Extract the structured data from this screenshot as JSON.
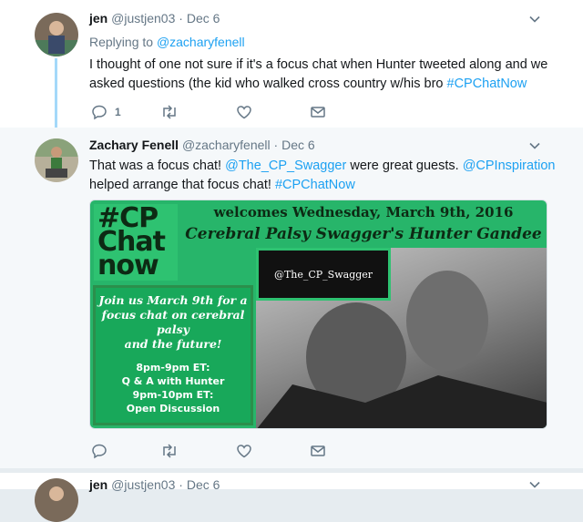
{
  "tweets": [
    {
      "name": "jen",
      "handle": "@justjen03",
      "separator": "·",
      "time": "Dec 6",
      "replying_prefix": "Replying to",
      "replying_to": "@zacharyfenell",
      "text": "I thought of one not sure if it's a focus chat when Hunter tweeted along and we asked questions (the kid who walked cross country w/his bro",
      "hashtag": "#CPChatNow",
      "reply_count": "1",
      "retweet_count": "",
      "like_count": ""
    },
    {
      "name": "Zachary Fenell",
      "handle": "@zacharyfenell",
      "separator": "·",
      "time": "Dec 6",
      "text_part1": "That was a focus chat!",
      "mention1": "@The_CP_Swagger",
      "text_part2": "were great guests.",
      "mention2": "@CPInspiration",
      "text_part3": "helped arrange that focus chat!",
      "hashtag": "#CPChatNow",
      "promo": {
        "logo_line1": "#CP",
        "logo_line2": "Chat",
        "logo_line3": "now",
        "welcome": "welcomes Wednesday, March 9th, 2016",
        "title": "Cerebral Palsy Swagger's Hunter Gandee",
        "handle_box": "@The_CP_Swagger",
        "lead_line1": "Join us March 9th for a",
        "lead_line2": "focus chat on cerebral palsy",
        "lead_line3": "and the future!",
        "sched_line1": "8pm-9pm ET:",
        "sched_line2": "Q & A with Hunter",
        "sched_line3": "9pm-10pm ET:",
        "sched_line4": "Open Discussion"
      }
    },
    {
      "name": "jen",
      "handle": "@justjen03",
      "separator": "·",
      "time": "Dec 6"
    }
  ],
  "colors": {
    "link": "#1da1f2",
    "secondary_text": "#657786",
    "thread_line": "#a4d9f9",
    "promo_green": "#27b56a"
  },
  "icons": [
    "reply-icon",
    "retweet-icon",
    "like-icon",
    "direct-message-icon",
    "chevron-down-icon"
  ]
}
